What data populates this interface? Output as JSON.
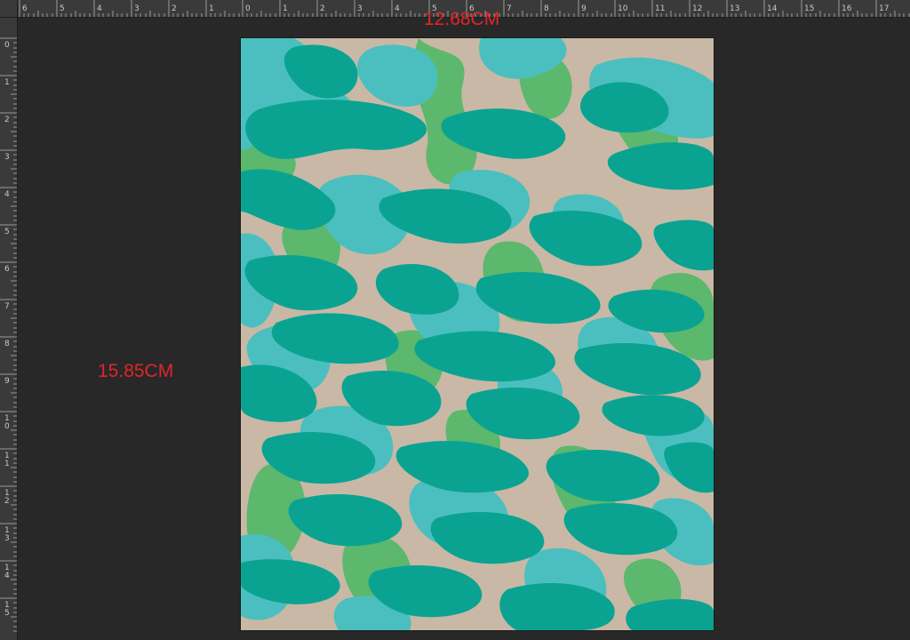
{
  "ruler": {
    "top_labels": [
      "6",
      "5",
      "4",
      "3",
      "2",
      "1",
      "0",
      "1",
      "2",
      "3",
      "4",
      "5",
      "6",
      "7",
      "8",
      "9",
      "10",
      "11",
      "12",
      "13",
      "14",
      "15",
      "16",
      "17"
    ],
    "left_labels": [
      "0",
      "1",
      "2",
      "3",
      "4",
      "5",
      "6",
      "7",
      "8",
      "9",
      "10",
      "11",
      "12",
      "13",
      "14",
      "15"
    ]
  },
  "document": {
    "width_label": "12.68CM",
    "height_label": "15.85CM"
  },
  "pattern": {
    "name": "camouflage",
    "colors": {
      "sand": "#c9b8a5",
      "green": "#5cb86c",
      "light_teal": "#4bbfbf",
      "dark_teal": "#0aa392"
    }
  },
  "colors": {
    "workspace": "#282828",
    "ruler": "#3a3a3a",
    "dimension_text": "#e0252b"
  }
}
